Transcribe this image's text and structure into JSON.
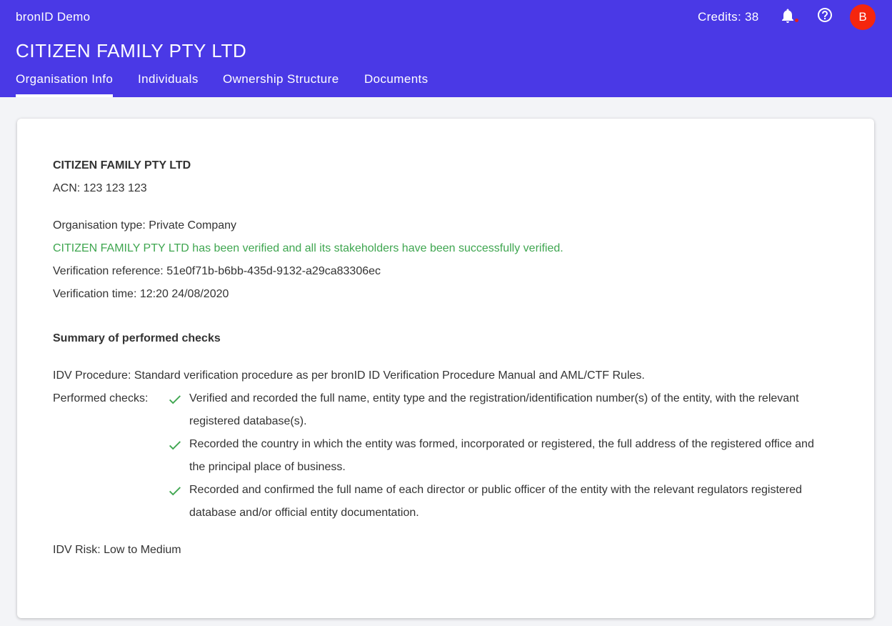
{
  "header": {
    "app_name": "bronID Demo",
    "credits": "Credits: 38",
    "avatar_initial": "B",
    "org_title": "CITIZEN FAMILY PTY LTD"
  },
  "tabs": [
    {
      "label": "Organisation Info",
      "active": true
    },
    {
      "label": "Individuals",
      "active": false
    },
    {
      "label": "Ownership Structure",
      "active": false
    },
    {
      "label": "Documents",
      "active": false
    }
  ],
  "org": {
    "name": "CITIZEN FAMILY PTY LTD",
    "acn": "ACN: 123 123 123",
    "type": "Organisation type: Private Company",
    "verified_message": "CITIZEN FAMILY PTY LTD has been verified and all its stakeholders have been successfully verified.",
    "verification_reference": "Verification reference: 51e0f71b-b6bb-435d-9132-a29ca83306ec",
    "verification_time": "Verification time: 12:20 24/08/2020"
  },
  "summary": {
    "heading": "Summary of performed checks",
    "procedure": "IDV Procedure: Standard verification procedure as per bronID ID Verification Procedure Manual and AML/CTF Rules.",
    "checks_label": "Performed checks:",
    "checks": [
      "Verified and recorded the full name, entity type and the registration/identification number(s) of the entity, with the relevant registered database(s).",
      "Recorded the country in which the entity was formed, incorporated or registered, the full address of the registered office and the principal place of business.",
      "Recorded and confirmed the full name of each director or public officer of the entity with the relevant regulators registered database and/or official entity documentation."
    ],
    "risk": "IDV Risk: Low to Medium"
  },
  "colors": {
    "header_bg": "#4a39e6",
    "avatar_bg": "#f5260d",
    "success_green": "#3fa650",
    "notification_dot": "#e41d1d"
  },
  "icons": {
    "notifications": "bell-icon",
    "help": "help-circle-icon",
    "check": "check-icon"
  }
}
